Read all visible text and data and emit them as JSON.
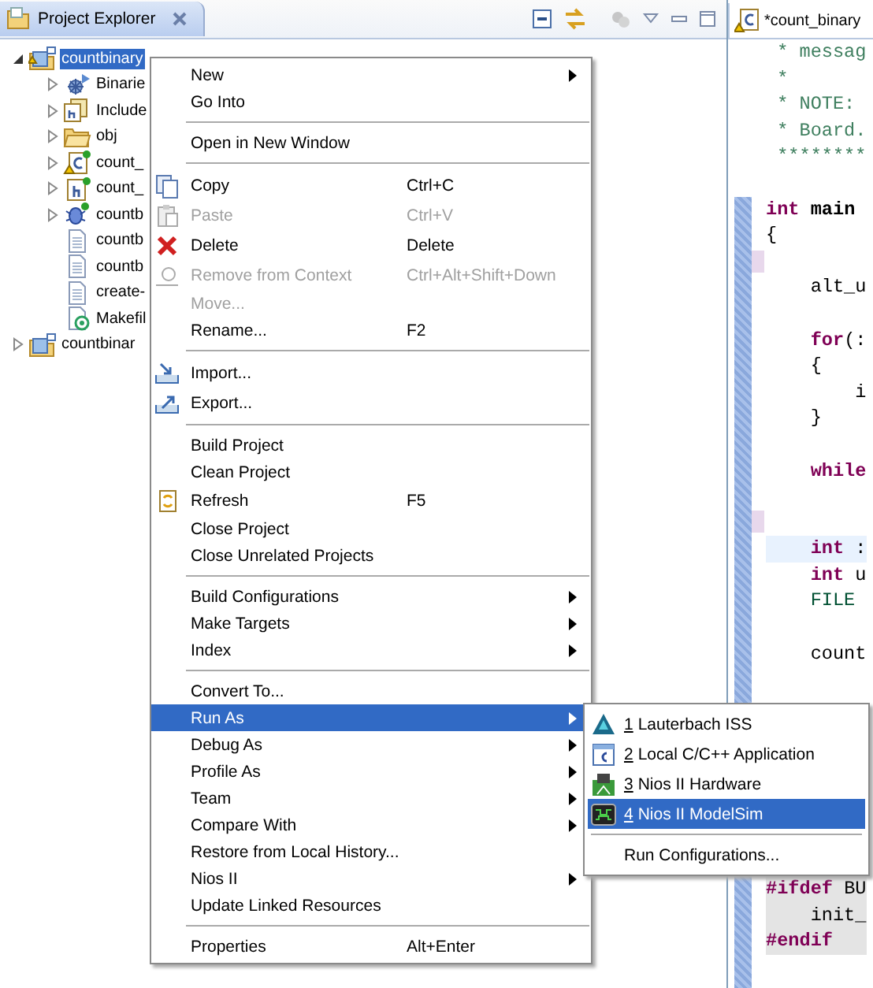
{
  "explorer": {
    "title": "Project Explorer"
  },
  "tree": [
    {
      "label": "countbinary",
      "kind": "project",
      "expanded": true,
      "selected": true,
      "children": [
        {
          "label": "Binarie",
          "kind": "binaries",
          "expanded": false,
          "selected": false
        },
        {
          "label": "Include",
          "kind": "includes",
          "expanded": false,
          "selected": false
        },
        {
          "label": "obj",
          "kind": "folder",
          "expanded": false,
          "selected": false
        },
        {
          "label": "count_",
          "kind": "csource",
          "expanded": false,
          "selected": false
        },
        {
          "label": "count_",
          "kind": "header",
          "expanded": false,
          "selected": false
        },
        {
          "label": "countb",
          "kind": "executable",
          "expanded": false,
          "selected": false
        },
        {
          "label": "countb",
          "kind": "text",
          "selected": false
        },
        {
          "label": "countb",
          "kind": "text",
          "selected": false
        },
        {
          "label": "create-",
          "kind": "text",
          "selected": false
        },
        {
          "label": "Makefil",
          "kind": "makefile",
          "selected": false
        }
      ]
    },
    {
      "label": "countbinar",
      "kind": "project",
      "expanded": false,
      "selected": false
    }
  ],
  "context_menu": {
    "items": [
      {
        "kind": "plain",
        "label": "New",
        "submenu": true,
        "disabled": false,
        "selected": false
      },
      {
        "kind": "plain",
        "label": "Go Into",
        "submenu": false,
        "disabled": false,
        "selected": false
      },
      {
        "kind": "separator"
      },
      {
        "kind": "plain",
        "label": "Open in New Window",
        "submenu": false,
        "disabled": false,
        "selected": false
      },
      {
        "kind": "separator"
      },
      {
        "kind": "copy",
        "label": "Copy",
        "shortcut": "Ctrl+C",
        "submenu": false,
        "disabled": false,
        "selected": false
      },
      {
        "kind": "paste",
        "label": "Paste",
        "shortcut": "Ctrl+V",
        "submenu": false,
        "disabled": true,
        "selected": false
      },
      {
        "kind": "delete",
        "label": "Delete",
        "shortcut": "Delete",
        "submenu": false,
        "disabled": false,
        "selected": false
      },
      {
        "kind": "remove",
        "label": "Remove from Context",
        "shortcut": "Ctrl+Alt+Shift+Down",
        "submenu": false,
        "disabled": true,
        "selected": false
      },
      {
        "kind": "plain",
        "label": "Move...",
        "submenu": false,
        "disabled": true,
        "selected": false
      },
      {
        "kind": "plain",
        "label": "Rename...",
        "shortcut": "F2",
        "submenu": false,
        "disabled": false,
        "selected": false
      },
      {
        "kind": "separator"
      },
      {
        "kind": "import",
        "label": "Import...",
        "submenu": false,
        "disabled": false,
        "selected": false
      },
      {
        "kind": "export",
        "label": "Export...",
        "submenu": false,
        "disabled": false,
        "selected": false
      },
      {
        "kind": "separator"
      },
      {
        "kind": "plain",
        "label": "Build Project",
        "submenu": false,
        "disabled": false,
        "selected": false
      },
      {
        "kind": "plain",
        "label": "Clean Project",
        "submenu": false,
        "disabled": false,
        "selected": false
      },
      {
        "kind": "refresh",
        "label": "Refresh",
        "shortcut": "F5",
        "submenu": false,
        "disabled": false,
        "selected": false
      },
      {
        "kind": "plain",
        "label": "Close Project",
        "submenu": false,
        "disabled": false,
        "selected": false
      },
      {
        "kind": "plain",
        "label": "Close Unrelated Projects",
        "submenu": false,
        "disabled": false,
        "selected": false
      },
      {
        "kind": "separator"
      },
      {
        "kind": "plain",
        "label": "Build Configurations",
        "submenu": true,
        "disabled": false,
        "selected": false
      },
      {
        "kind": "plain",
        "label": "Make Targets",
        "submenu": true,
        "disabled": false,
        "selected": false
      },
      {
        "kind": "plain",
        "label": "Index",
        "submenu": true,
        "disabled": false,
        "selected": false
      },
      {
        "kind": "separator"
      },
      {
        "kind": "plain",
        "label": "Convert To...",
        "submenu": false,
        "disabled": false,
        "selected": false
      },
      {
        "kind": "plain",
        "label": "Run As",
        "submenu": true,
        "disabled": false,
        "selected": true
      },
      {
        "kind": "plain",
        "label": "Debug As",
        "submenu": true,
        "disabled": false,
        "selected": false
      },
      {
        "kind": "plain",
        "label": "Profile As",
        "submenu": true,
        "disabled": false,
        "selected": false
      },
      {
        "kind": "plain",
        "label": "Team",
        "submenu": true,
        "disabled": false,
        "selected": false
      },
      {
        "kind": "plain",
        "label": "Compare With",
        "submenu": true,
        "disabled": false,
        "selected": false
      },
      {
        "kind": "plain",
        "label": "Restore from Local History...",
        "submenu": false,
        "disabled": false,
        "selected": false
      },
      {
        "kind": "plain",
        "label": "Nios II",
        "submenu": true,
        "disabled": false,
        "selected": false
      },
      {
        "kind": "plain",
        "label": "Update Linked Resources",
        "submenu": false,
        "disabled": false,
        "selected": false
      },
      {
        "kind": "separator"
      },
      {
        "kind": "plain",
        "label": "Properties",
        "shortcut": "Alt+Enter",
        "submenu": false,
        "disabled": false,
        "selected": false
      }
    ]
  },
  "run_as_menu": {
    "items": [
      {
        "kind": "pyramid",
        "number": "1",
        "label": "Lauterbach ISS",
        "selected": false
      },
      {
        "kind": "capp",
        "number": "2",
        "label": "Local C/C++ Application",
        "selected": false
      },
      {
        "kind": "board",
        "number": "3",
        "label": "Nios II Hardware",
        "selected": false
      },
      {
        "kind": "wave",
        "number": "4",
        "label": "Nios II ModelSim",
        "selected": true
      },
      {
        "kind": "separator"
      },
      {
        "kind": "plain",
        "label": "Run Configurations...",
        "selected": false
      }
    ]
  },
  "editor": {
    "tab": {
      "title": "*count_binary"
    },
    "lines": [
      {
        "kind": "code",
        "current": false,
        "inactive": false,
        "tokens": [
          {
            "kind": "comment",
            "text": " * messag"
          }
        ]
      },
      {
        "kind": "code",
        "current": false,
        "inactive": false,
        "tokens": [
          {
            "kind": "comment",
            "text": " *"
          }
        ]
      },
      {
        "kind": "code",
        "current": false,
        "inactive": false,
        "tokens": [
          {
            "kind": "comment",
            "text": " * NOTE:"
          }
        ]
      },
      {
        "kind": "code",
        "current": false,
        "inactive": false,
        "tokens": [
          {
            "kind": "comment",
            "text": " * Board."
          }
        ]
      },
      {
        "kind": "code",
        "current": false,
        "inactive": false,
        "tokens": [
          {
            "kind": "comment",
            "text": " ********"
          }
        ]
      },
      {
        "kind": "blank"
      },
      {
        "kind": "code",
        "current": false,
        "inactive": false,
        "tokens": [
          {
            "kind": "keyword",
            "text": "int"
          },
          {
            "kind": "function",
            "text": " main"
          }
        ]
      },
      {
        "kind": "code",
        "current": false,
        "inactive": false,
        "tokens": [
          {
            "kind": "plain",
            "text": "{"
          }
        ]
      },
      {
        "kind": "blank"
      },
      {
        "kind": "code",
        "current": false,
        "inactive": false,
        "tokens": [
          {
            "kind": "plain",
            "text": "    alt_u"
          }
        ]
      },
      {
        "kind": "blank"
      },
      {
        "kind": "code",
        "current": false,
        "inactive": false,
        "tokens": [
          {
            "kind": "keyword",
            "text": "    for"
          },
          {
            "kind": "plain",
            "text": "(:"
          }
        ]
      },
      {
        "kind": "code",
        "current": false,
        "inactive": false,
        "tokens": [
          {
            "kind": "plain",
            "text": "    {"
          }
        ]
      },
      {
        "kind": "code",
        "current": false,
        "inactive": false,
        "tokens": [
          {
            "kind": "plain",
            "text": "        i"
          }
        ]
      },
      {
        "kind": "code",
        "current": false,
        "inactive": false,
        "tokens": [
          {
            "kind": "plain",
            "text": "    }"
          }
        ]
      },
      {
        "kind": "blank"
      },
      {
        "kind": "code",
        "current": false,
        "inactive": false,
        "tokens": [
          {
            "kind": "keyword",
            "text": "    while"
          }
        ]
      },
      {
        "kind": "blank"
      },
      {
        "kind": "blank"
      },
      {
        "kind": "code",
        "current": true,
        "inactive": false,
        "tokens": [
          {
            "kind": "keyword",
            "text": "    int"
          },
          {
            "kind": "plain",
            "text": " :"
          }
        ]
      },
      {
        "kind": "code",
        "current": false,
        "inactive": false,
        "tokens": [
          {
            "kind": "keyword",
            "text": "    int"
          },
          {
            "kind": "plain",
            "text": " u"
          }
        ]
      },
      {
        "kind": "code",
        "current": false,
        "inactive": false,
        "tokens": [
          {
            "kind": "type",
            "text": "    FILE"
          }
        ]
      },
      {
        "kind": "blank"
      },
      {
        "kind": "code",
        "current": false,
        "inactive": false,
        "tokens": [
          {
            "kind": "plain",
            "text": "    count"
          }
        ]
      },
      {
        "kind": "blank"
      },
      {
        "kind": "blank"
      },
      {
        "kind": "blank"
      },
      {
        "kind": "blank"
      },
      {
        "kind": "blank"
      },
      {
        "kind": "blank"
      },
      {
        "kind": "blank"
      },
      {
        "kind": "blank"
      },
      {
        "kind": "code",
        "current": false,
        "inactive": true,
        "tokens": [
          {
            "kind": "keyword",
            "text": "#ifdef"
          },
          {
            "kind": "plain",
            "text": " BU"
          }
        ]
      },
      {
        "kind": "code",
        "current": false,
        "inactive": true,
        "tokens": [
          {
            "kind": "plain",
            "text": "    init_"
          }
        ]
      },
      {
        "kind": "code",
        "current": false,
        "inactive": true,
        "tokens": [
          {
            "kind": "keyword",
            "text": "#endif"
          }
        ]
      }
    ]
  }
}
